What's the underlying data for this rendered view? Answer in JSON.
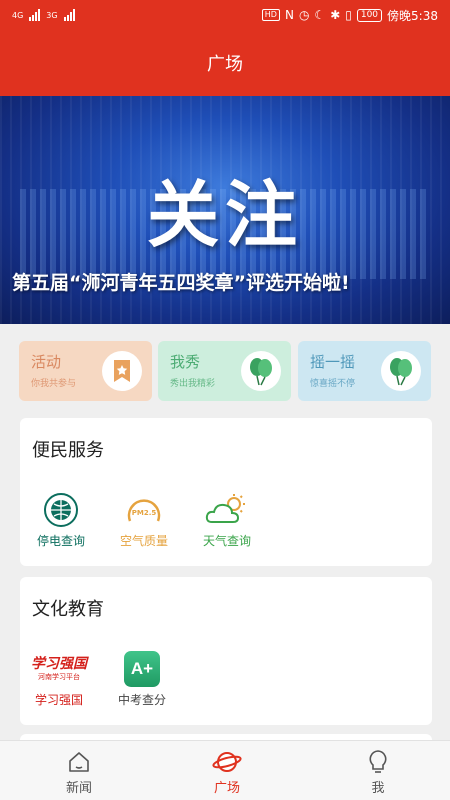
{
  "status_bar": {
    "signal1_label": "4G",
    "signal2_label": "3G",
    "hd_label": "HD",
    "nfc_label": "N",
    "battery": "100",
    "time": "傍晚5:38"
  },
  "header": {
    "title": "广场"
  },
  "banner": {
    "headline": "关注",
    "caption": "第五届“浉河青年五四奖章”评选开始啦!"
  },
  "quick_cards": [
    {
      "title": "活动",
      "subtitle": "你我共参与",
      "icon": "ribbon-star-icon",
      "color": "#d98860"
    },
    {
      "title": "我秀",
      "subtitle": "秀出我精彩",
      "icon": "balloons-icon",
      "color": "#4dac74"
    },
    {
      "title": "摇一摇",
      "subtitle": "惊喜摇不停",
      "icon": "balloons-icon",
      "color": "#4e97b9"
    }
  ],
  "sections": {
    "services": {
      "title": "便民服务",
      "items": [
        {
          "label": "停电查询",
          "icon": "state-grid-icon",
          "color": "#0c6e5e"
        },
        {
          "label": "空气质量",
          "icon": "pm25-icon",
          "color": "#e5a33f"
        },
        {
          "label": "天气查询",
          "icon": "weather-icon",
          "color": "#3aa44a"
        }
      ]
    },
    "culture": {
      "title": "文化教育",
      "items": [
        {
          "label": "学习强国",
          "logo_text": "学习强国",
          "logo_sub": "河南学习平台",
          "icon": "xuexi-logo",
          "color": "#d4201b"
        },
        {
          "label": "中考查分",
          "icon_text": "A+",
          "icon": "score-icon",
          "color": "#2aa874"
        }
      ]
    }
  },
  "tabs": [
    {
      "label": "新闻",
      "icon": "home-icon",
      "active": false
    },
    {
      "label": "广场",
      "icon": "planet-icon",
      "active": true
    },
    {
      "label": "我",
      "icon": "bulb-icon",
      "active": false
    }
  ]
}
